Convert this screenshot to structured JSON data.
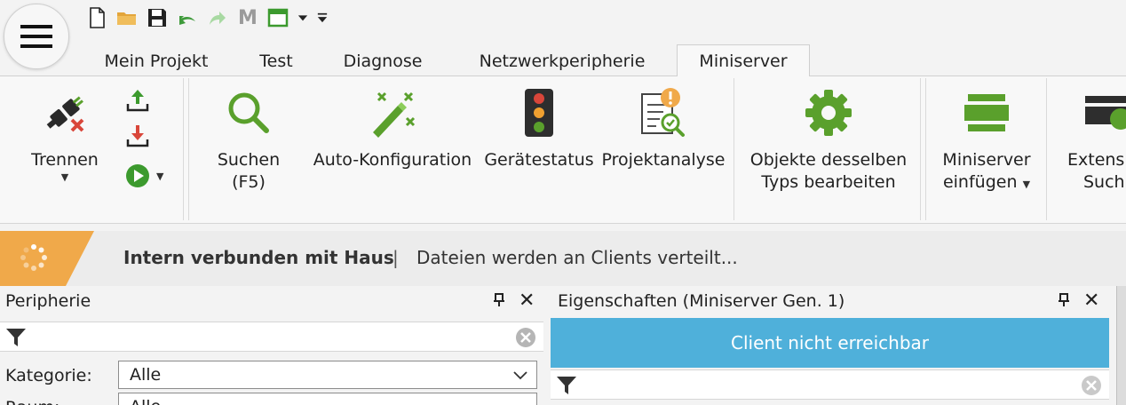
{
  "quick_access": {
    "icons": [
      "new-document-icon",
      "open-folder-icon",
      "save-icon",
      "undo-icon",
      "redo-icon",
      "m-icon",
      "window-icon",
      "dropdown-icon",
      "customize-icon"
    ],
    "m_label": "M"
  },
  "tabs": [
    {
      "label": "Mein Projekt",
      "active": false
    },
    {
      "label": "Test",
      "active": false
    },
    {
      "label": "Diagnose",
      "active": false
    },
    {
      "label": "Netzwerkperipherie",
      "active": false
    },
    {
      "label": "Miniserver",
      "active": true
    }
  ],
  "ribbon": {
    "disconnect": {
      "label": "Trennen"
    },
    "search": {
      "label_line1": "Suchen",
      "label_line2": "(F5)"
    },
    "auto_config": {
      "label": "Auto-Konfiguration"
    },
    "device_status": {
      "label": "Gerätestatus"
    },
    "project_analysis": {
      "label": "Projektanalyse"
    },
    "edit_same_type": {
      "label_line1": "Objekte desselben",
      "label_line2": "Typs bearbeiten"
    },
    "insert_miniserver": {
      "label_line1": "Miniserver",
      "label_line2": "einfügen"
    },
    "extension_search": {
      "label_line1": "Extensi",
      "label_line2": "Such"
    }
  },
  "status": {
    "main": "Intern verbunden mit Haus",
    "separator": "|",
    "sub": "Dateien werden an Clients verteilt..."
  },
  "left_panel": {
    "title": "Peripherie",
    "filter_placeholder": "",
    "category_label": "Kategorie:",
    "category_value": "Alle",
    "room_label": "Raum:",
    "room_value": "Alle"
  },
  "right_panel": {
    "title": "Eigenschaften (Miniserver Gen. 1)",
    "banner": "Client nicht erreichbar",
    "filter_placeholder": ""
  },
  "colors": {
    "accent_green": "#5aa02c",
    "banner_blue": "#4fb0da",
    "status_orange": "#f0a94a"
  }
}
